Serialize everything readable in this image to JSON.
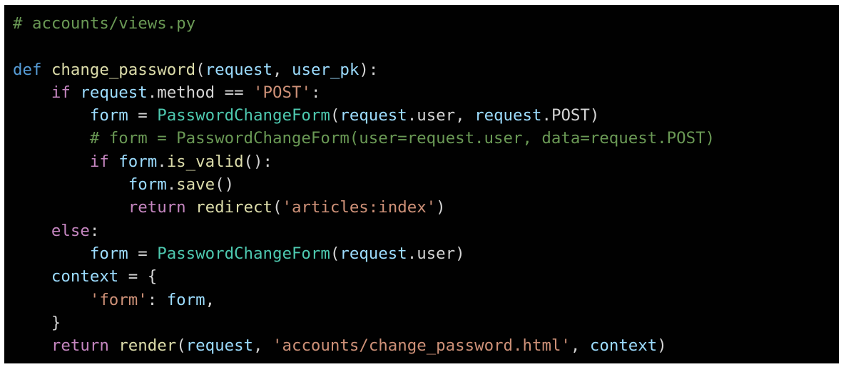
{
  "colors": {
    "background": "#010101",
    "comment": "#6a9955",
    "keyword": "#569cd6",
    "control": "#c586c0",
    "function": "#dcdcaa",
    "variable": "#9cdcfe",
    "class": "#4ec9b0",
    "string": "#ce9178",
    "plain": "#d4d4d4"
  },
  "code": {
    "lines": [
      [
        {
          "t": "# accounts/views.py",
          "c": "comment"
        }
      ],
      [],
      [
        {
          "t": "def",
          "c": "keyword"
        },
        {
          "t": " ",
          "c": "plain"
        },
        {
          "t": "change_password",
          "c": "function"
        },
        {
          "t": "(",
          "c": "plain"
        },
        {
          "t": "request",
          "c": "variable"
        },
        {
          "t": ", ",
          "c": "plain"
        },
        {
          "t": "user_pk",
          "c": "variable"
        },
        {
          "t": "):",
          "c": "plain"
        }
      ],
      [
        {
          "t": "    ",
          "c": "plain"
        },
        {
          "t": "if",
          "c": "control"
        },
        {
          "t": " ",
          "c": "plain"
        },
        {
          "t": "request",
          "c": "variable"
        },
        {
          "t": ".method == ",
          "c": "plain"
        },
        {
          "t": "'POST'",
          "c": "string"
        },
        {
          "t": ":",
          "c": "plain"
        }
      ],
      [
        {
          "t": "        ",
          "c": "plain"
        },
        {
          "t": "form",
          "c": "variable"
        },
        {
          "t": " = ",
          "c": "plain"
        },
        {
          "t": "PasswordChangeForm",
          "c": "class"
        },
        {
          "t": "(",
          "c": "plain"
        },
        {
          "t": "request",
          "c": "variable"
        },
        {
          "t": ".user, ",
          "c": "plain"
        },
        {
          "t": "request",
          "c": "variable"
        },
        {
          "t": ".POST)",
          "c": "plain"
        }
      ],
      [
        {
          "t": "        ",
          "c": "plain"
        },
        {
          "t": "# form = PasswordChangeForm(user=request.user, data=request.POST)",
          "c": "comment"
        }
      ],
      [
        {
          "t": "        ",
          "c": "plain"
        },
        {
          "t": "if",
          "c": "control"
        },
        {
          "t": " ",
          "c": "plain"
        },
        {
          "t": "form",
          "c": "variable"
        },
        {
          "t": ".",
          "c": "plain"
        },
        {
          "t": "is_valid",
          "c": "function"
        },
        {
          "t": "():",
          "c": "plain"
        }
      ],
      [
        {
          "t": "            ",
          "c": "plain"
        },
        {
          "t": "form",
          "c": "variable"
        },
        {
          "t": ".",
          "c": "plain"
        },
        {
          "t": "save",
          "c": "function"
        },
        {
          "t": "()",
          "c": "plain"
        }
      ],
      [
        {
          "t": "            ",
          "c": "plain"
        },
        {
          "t": "return",
          "c": "control"
        },
        {
          "t": " ",
          "c": "plain"
        },
        {
          "t": "redirect",
          "c": "function"
        },
        {
          "t": "(",
          "c": "plain"
        },
        {
          "t": "'articles:index'",
          "c": "string"
        },
        {
          "t": ")",
          "c": "plain"
        }
      ],
      [
        {
          "t": "    ",
          "c": "plain"
        },
        {
          "t": "else",
          "c": "control"
        },
        {
          "t": ":",
          "c": "plain"
        }
      ],
      [
        {
          "t": "        ",
          "c": "plain"
        },
        {
          "t": "form",
          "c": "variable"
        },
        {
          "t": " = ",
          "c": "plain"
        },
        {
          "t": "PasswordChangeForm",
          "c": "class"
        },
        {
          "t": "(",
          "c": "plain"
        },
        {
          "t": "request",
          "c": "variable"
        },
        {
          "t": ".user)",
          "c": "plain"
        }
      ],
      [
        {
          "t": "    ",
          "c": "plain"
        },
        {
          "t": "context",
          "c": "variable"
        },
        {
          "t": " = {",
          "c": "plain"
        }
      ],
      [
        {
          "t": "        ",
          "c": "plain"
        },
        {
          "t": "'form'",
          "c": "string"
        },
        {
          "t": ": ",
          "c": "plain"
        },
        {
          "t": "form",
          "c": "variable"
        },
        {
          "t": ",",
          "c": "plain"
        }
      ],
      [
        {
          "t": "    }",
          "c": "plain"
        }
      ],
      [
        {
          "t": "    ",
          "c": "plain"
        },
        {
          "t": "return",
          "c": "control"
        },
        {
          "t": " ",
          "c": "plain"
        },
        {
          "t": "render",
          "c": "function"
        },
        {
          "t": "(",
          "c": "plain"
        },
        {
          "t": "request",
          "c": "variable"
        },
        {
          "t": ", ",
          "c": "plain"
        },
        {
          "t": "'accounts/change_password.html'",
          "c": "string"
        },
        {
          "t": ", ",
          "c": "plain"
        },
        {
          "t": "context",
          "c": "variable"
        },
        {
          "t": ")",
          "c": "plain"
        }
      ]
    ]
  }
}
